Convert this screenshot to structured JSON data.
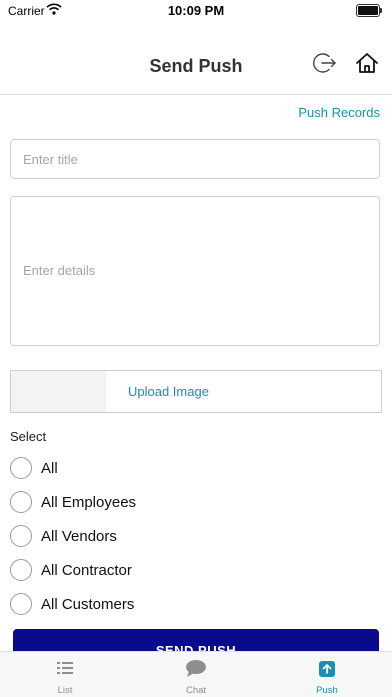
{
  "status_bar": {
    "carrier": "Carrier",
    "time": "10:09 PM"
  },
  "header": {
    "title": "Send Push"
  },
  "links": {
    "push_records": "Push Records"
  },
  "form": {
    "title_placeholder": "Enter title",
    "details_placeholder": "Enter details",
    "upload_label": "Upload Image",
    "select_label": "Select",
    "options": [
      "All",
      "All Employees",
      "All Vendors",
      "All Contractor",
      "All Customers"
    ],
    "send_label": "SEND PUSH"
  },
  "tabs": [
    {
      "label": "List",
      "icon": "list-icon"
    },
    {
      "label": "Chat",
      "icon": "chat-icon"
    },
    {
      "label": "Push",
      "icon": "push-icon"
    }
  ],
  "colors": {
    "accent": "#1a8fb3",
    "button": "#0a0a8c"
  }
}
